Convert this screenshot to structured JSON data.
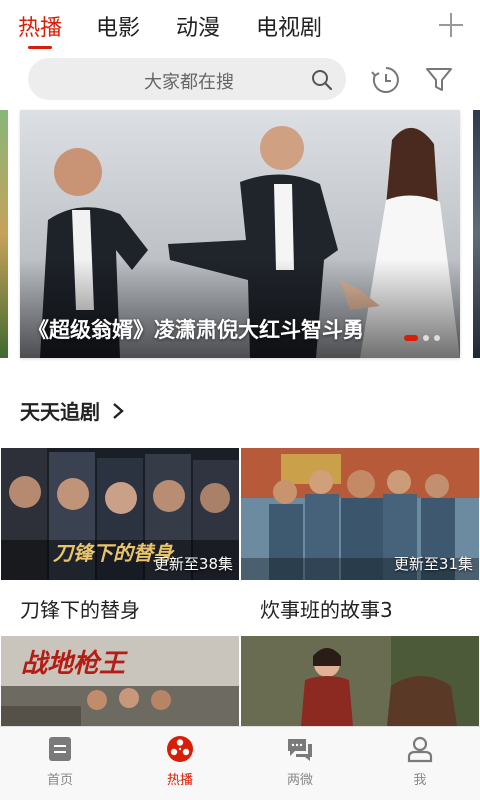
{
  "top_tabs": [
    {
      "label": "热播",
      "active": true
    },
    {
      "label": "电影",
      "active": false
    },
    {
      "label": "动漫",
      "active": false
    },
    {
      "label": "电视剧",
      "active": false
    }
  ],
  "icons": {
    "add": "plus-icon",
    "search": "search-icon",
    "history": "history-icon",
    "filter": "filter-icon",
    "section_more": "chevron-right-icon"
  },
  "search": {
    "placeholder": "大家都在搜"
  },
  "banner": {
    "caption": "《超级翁婿》凌潇肃倪大红斗智斗勇",
    "dot_count": 3,
    "active_dot": 0
  },
  "section": {
    "title": "天天追剧",
    "arrow": ">"
  },
  "cards": [
    {
      "title": "刀锋下的替身",
      "badge": "更新至38集",
      "poster_text": "刀锋下的替身"
    },
    {
      "title": "炊事班的故事3",
      "badge": "更新至31集"
    },
    {
      "title": "",
      "badge": "",
      "poster_text": "战地枪王"
    },
    {
      "title": "",
      "badge": ""
    }
  ],
  "bottom_nav": [
    {
      "label": "首页",
      "icon": "home-icon",
      "active": false
    },
    {
      "label": "热播",
      "icon": "film-reel-icon",
      "active": true
    },
    {
      "label": "两微",
      "icon": "chat-icon",
      "active": false
    },
    {
      "label": "我",
      "icon": "profile-icon",
      "active": false
    }
  ],
  "colors": {
    "accent": "#d81e06",
    "inactive": "#888888",
    "search_bg": "#ededed"
  }
}
